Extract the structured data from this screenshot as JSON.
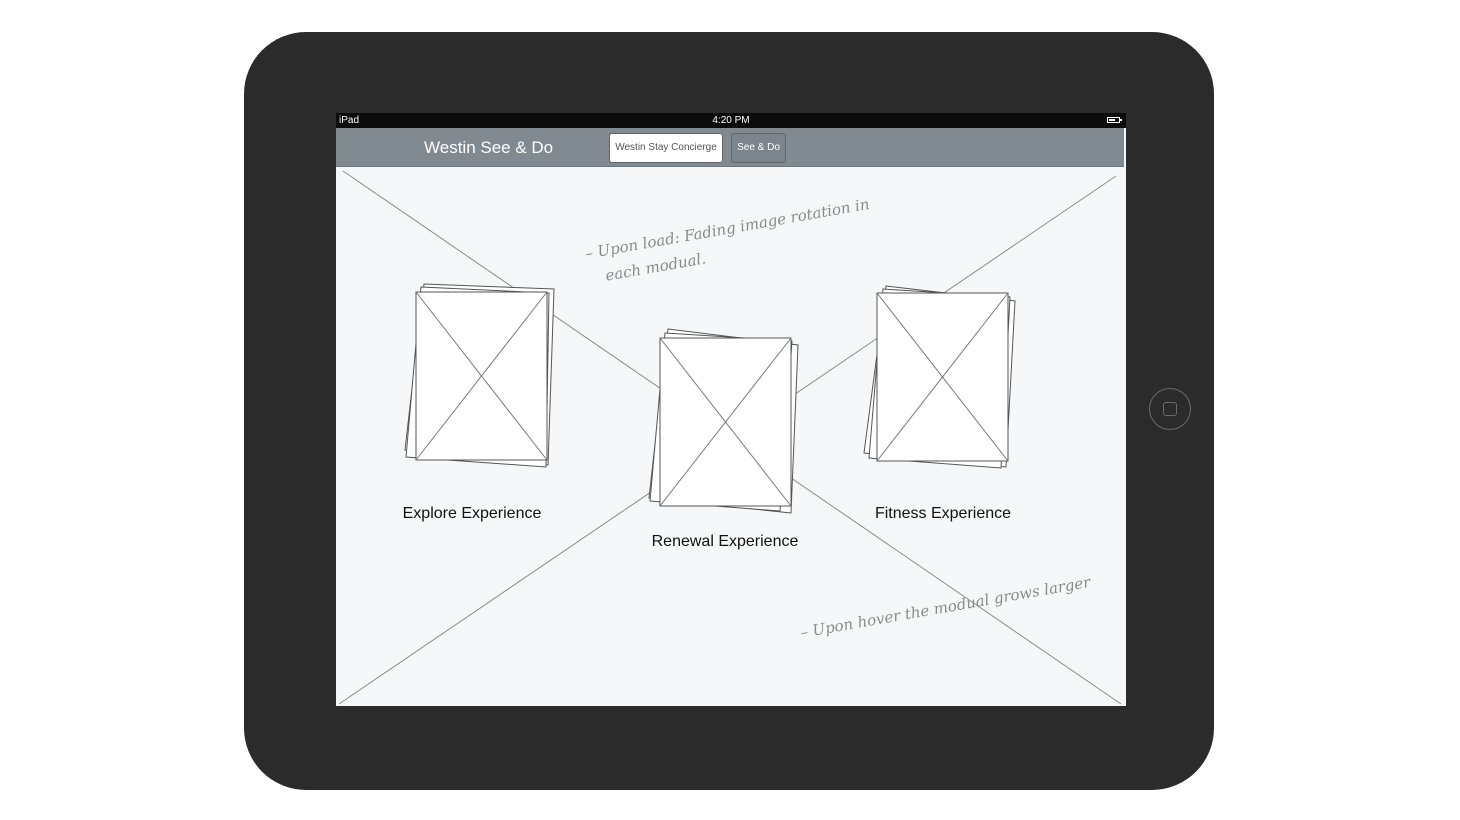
{
  "device": {
    "status_bar": {
      "device_name": "iPad",
      "time": "4:20 PM"
    }
  },
  "nav": {
    "title": "Westin See & Do",
    "segments": [
      {
        "label": "Westin Stay Concierge",
        "selected": true
      },
      {
        "label": "See & Do",
        "selected": false
      }
    ]
  },
  "modules": [
    {
      "label": "Explore Experience"
    },
    {
      "label": "Renewal Experience"
    },
    {
      "label": "Fitness Experience"
    }
  ],
  "notes": {
    "load_line1": "– Upon load: Fading image rotation in",
    "load_line2": "each modual.",
    "hover": "– Upon hover the modual grows larger"
  },
  "colors": {
    "device_frame": "#2b2b2b",
    "nav_bar": "#828a91",
    "screen_bg": "#f6f7f9",
    "status_bar": "#0b0b0b"
  }
}
